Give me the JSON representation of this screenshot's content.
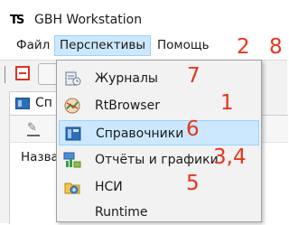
{
  "window": {
    "title": "GBH Workstation"
  },
  "menubar": {
    "items": [
      "Файл",
      "Перспективы",
      "Помощь"
    ],
    "annotations": [
      "2",
      "8"
    ]
  },
  "view_tab": {
    "label": "Сп"
  },
  "panel": {
    "column_header": "Назва"
  },
  "dropdown": {
    "items": [
      {
        "label": "Журналы",
        "annotation": "7",
        "icon": "journals-icon"
      },
      {
        "label": "RtBrowser",
        "annotation": "1",
        "icon": "rtbrowser-icon"
      },
      {
        "label": "Справочники",
        "annotation": "6",
        "icon": "reference-books-icon"
      },
      {
        "label": "Отчёты и графики",
        "annotation": "3,4",
        "icon": "reports-icon"
      },
      {
        "label": "НСИ",
        "annotation": "5",
        "icon": "nsi-icon"
      },
      {
        "label": "Runtime",
        "annotation": "",
        "icon": ""
      }
    ]
  },
  "colors": {
    "annotation_red": "#e8351c",
    "menu_highlight": "#cce8ff"
  }
}
